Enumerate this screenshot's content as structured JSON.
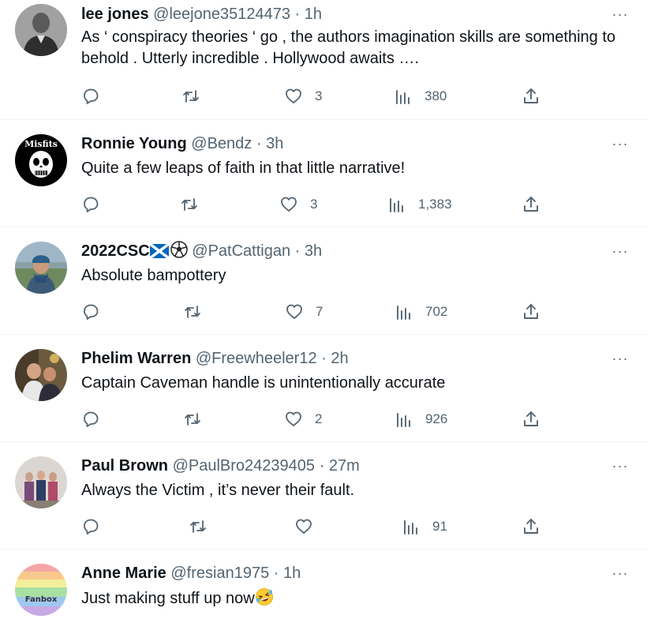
{
  "tweets": [
    {
      "name": "lee jones",
      "handle": "@leejone35124473",
      "time": "1h",
      "text": "As ‘ conspiracy theories ‘ go , the authors imagination skills are something to behold . Utterly incredible . Hollywood awaits ….",
      "likes": "3",
      "views": "380"
    },
    {
      "name": "Ronnie Young",
      "handle": "@Bendz",
      "time": "3h",
      "text": "Quite a few leaps of faith in that little narrative!",
      "likes": "3",
      "views": "1,383",
      "avatar_text": "Misfits"
    },
    {
      "name": "2022CSC",
      "handle": "@PatCattigan",
      "time": "3h",
      "text": "Absolute bampottery",
      "likes": "7",
      "views": "702"
    },
    {
      "name": "Phelim Warren",
      "handle": "@Freewheeler12",
      "time": "2h",
      "text": "Captain Caveman handle is unintentionally accurate",
      "likes": "2",
      "views": "926"
    },
    {
      "name": "Paul Brown",
      "handle": "@PaulBro24239405",
      "time": "27m",
      "text": "Always the Victim , it’s never their fault.",
      "likes": "",
      "views": "91"
    },
    {
      "name": "Anne Marie",
      "handle": "@fresian1975",
      "time": "1h",
      "text": "Just making stuff up now",
      "avatar_text": "Fanbox"
    }
  ],
  "sep": "·",
  "more": "···",
  "colors": {
    "text": "#0f1419",
    "secondary": "#536471",
    "divider": "#eff3f4"
  },
  "icons": [
    "reply-icon",
    "retweet-icon",
    "like-icon",
    "views-icon",
    "share-icon",
    "more-icon"
  ]
}
